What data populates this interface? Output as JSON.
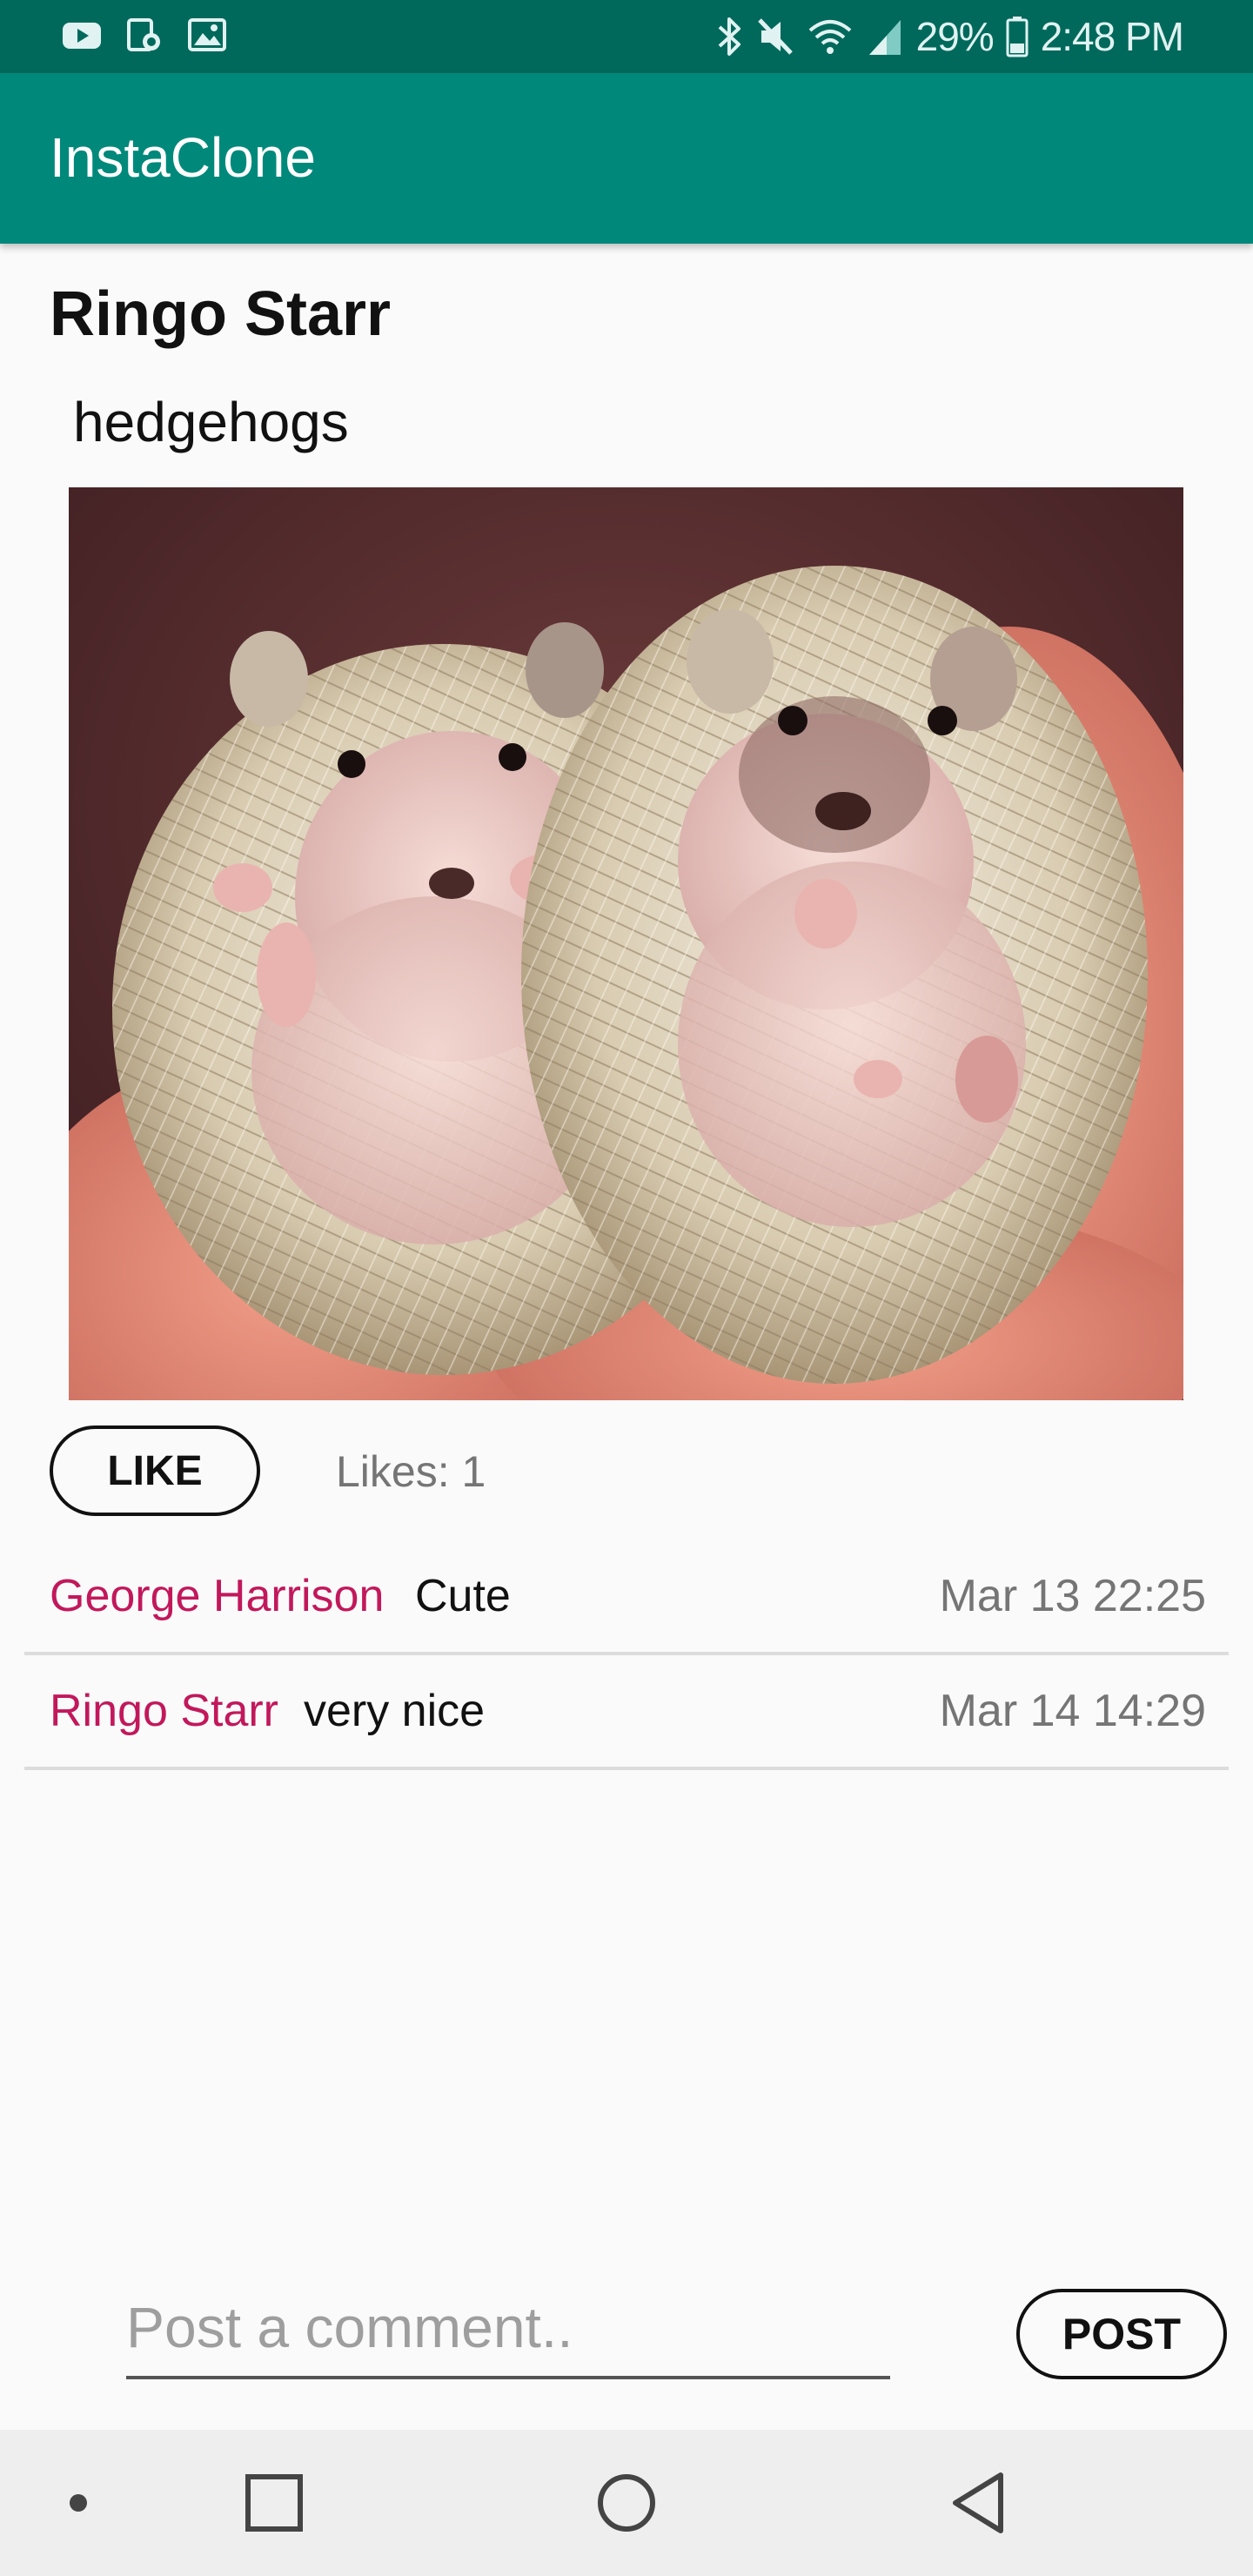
{
  "status_bar": {
    "battery": "29%",
    "time": "2:48 PM",
    "left_icons": [
      "youtube-icon",
      "screen-recorder-icon",
      "gallery-icon"
    ],
    "right_icons": [
      "bluetooth-icon",
      "mute-icon",
      "wifi-icon",
      "cell-signal-icon",
      "battery-icon"
    ]
  },
  "app_bar": {
    "title": "InstaClone"
  },
  "post": {
    "author": "Ringo Starr",
    "caption": "hedgehogs",
    "image_alt": "hedgehog-photo"
  },
  "like": {
    "button_label": "LIKE",
    "count_text": "Likes: 1"
  },
  "comments": [
    {
      "user": "George Harrison",
      "text": "Cute",
      "time": "Mar 13 22:25"
    },
    {
      "user": "Ringo Starr",
      "text": "very nice",
      "time": "Mar 14 14:29"
    }
  ],
  "composer": {
    "placeholder": "Post a comment..",
    "value": "",
    "post_label": "POST"
  },
  "nav_bar": {
    "items": [
      "recents-dot-icon",
      "overview-square-icon",
      "home-circle-icon",
      "back-triangle-icon"
    ]
  },
  "colors": {
    "status_bar": "#00695c",
    "app_bar": "#00897b",
    "username": "#c2185b",
    "secondary_text": "#757575",
    "background": "#fafafa"
  }
}
